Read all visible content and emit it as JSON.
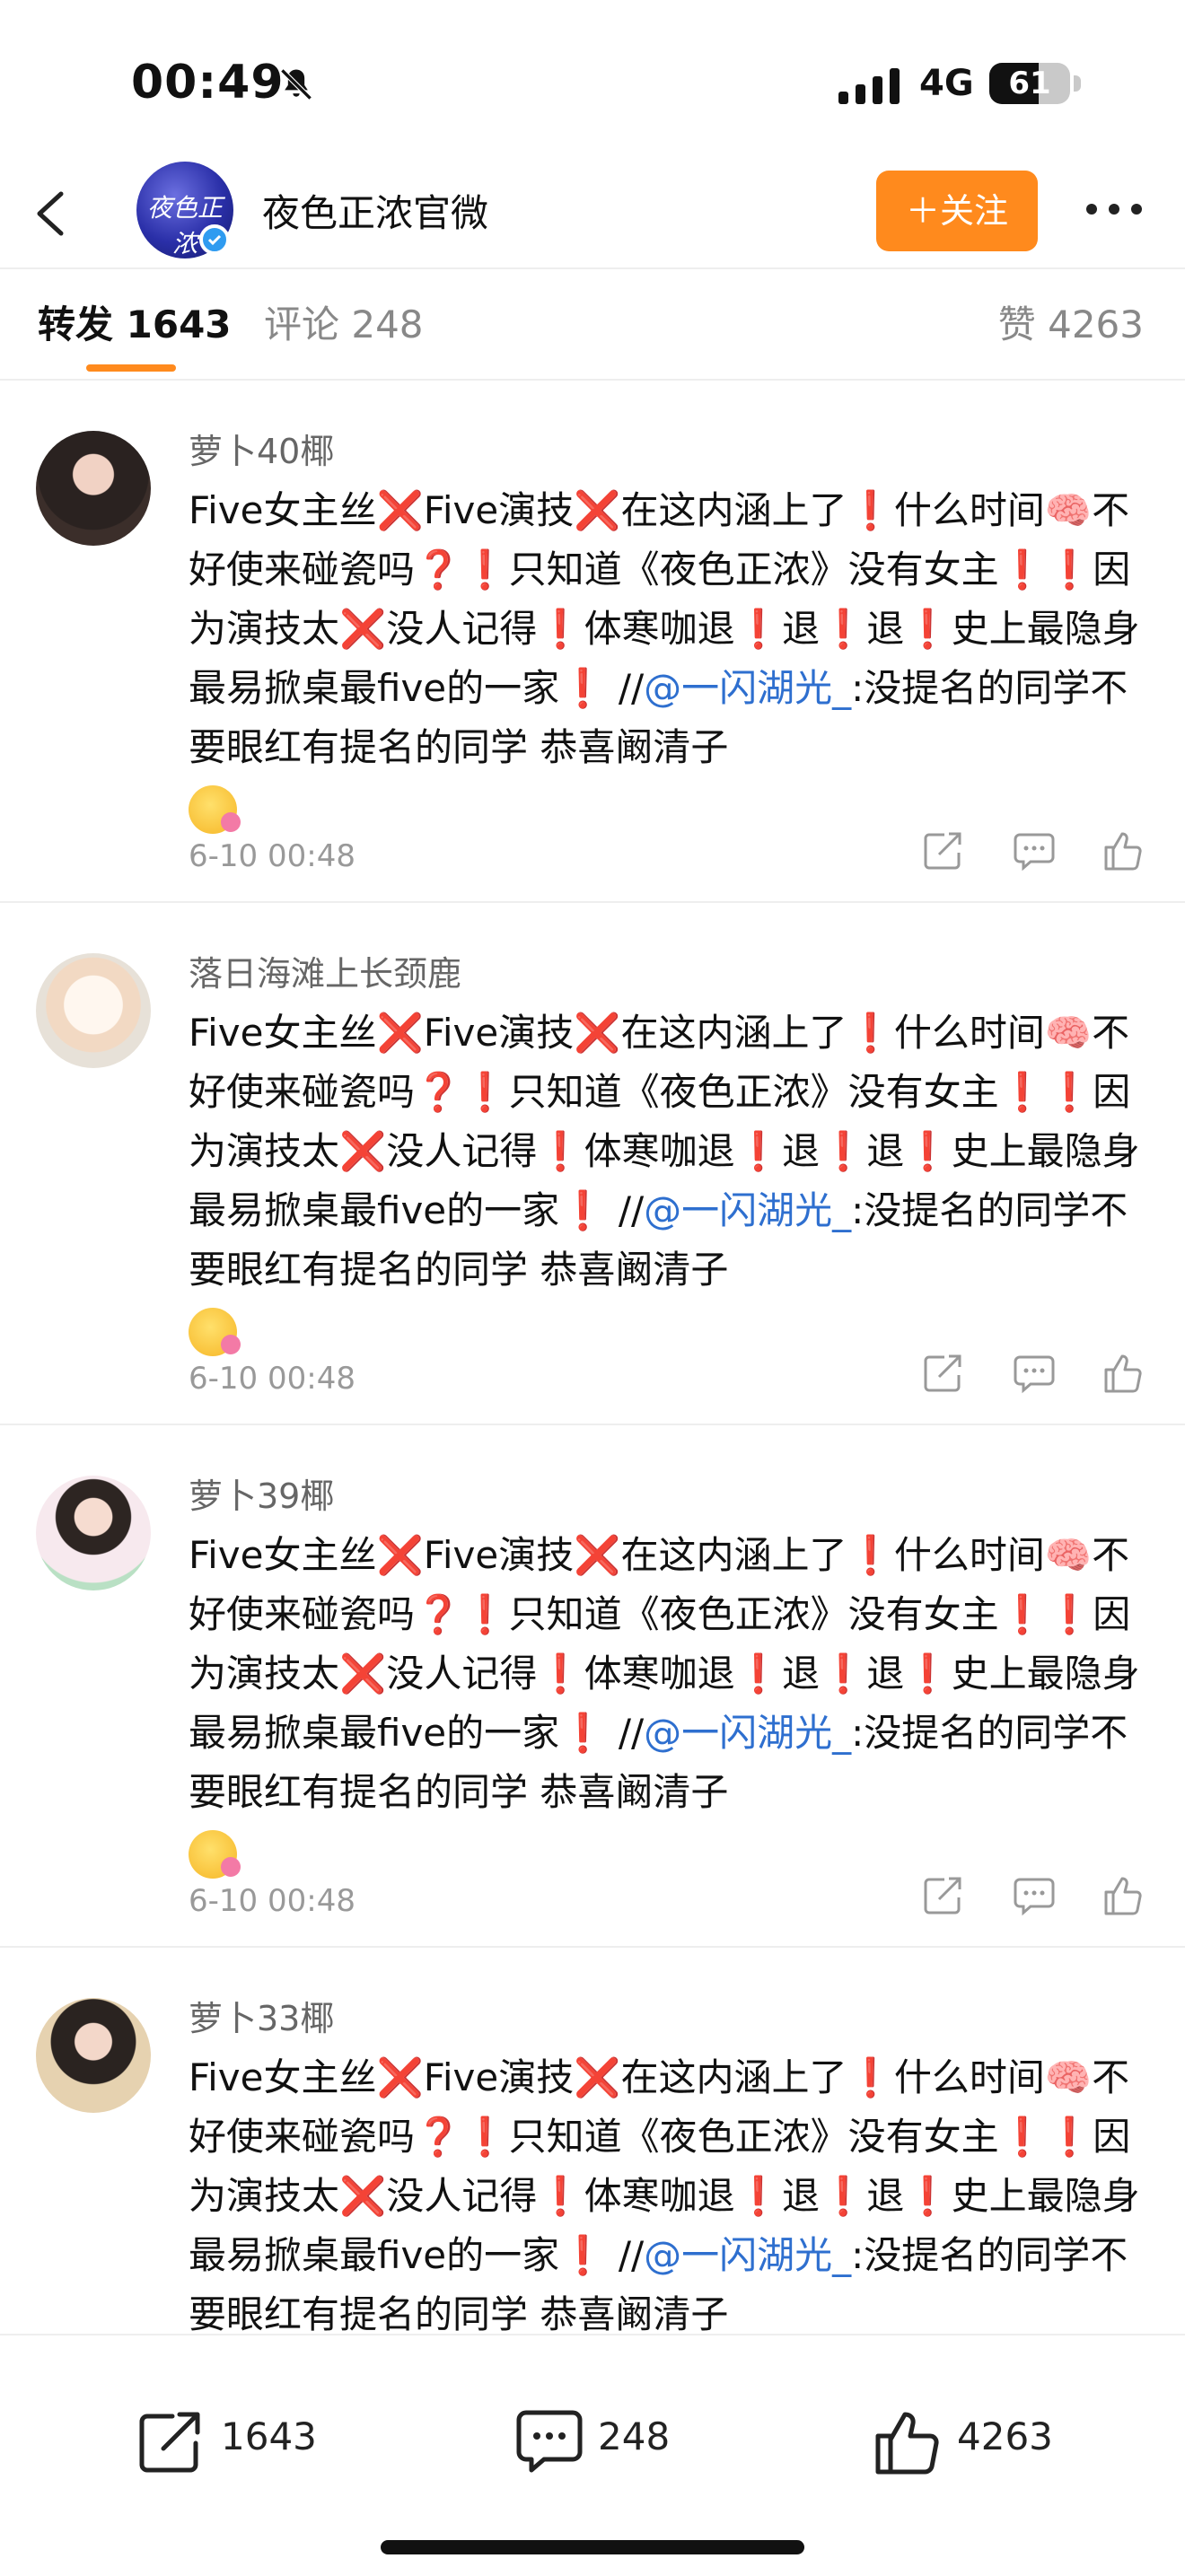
{
  "status": {
    "time": "00:49",
    "network": "4G",
    "battery": "61",
    "battery_level": 0.61
  },
  "header": {
    "title": "夜色正浓官微",
    "follow_label": "＋关注",
    "avatar_text": "夜色正浓"
  },
  "tabs": {
    "repost": "转发 1643",
    "comment": "评论 248",
    "like": "赞 4263"
  },
  "posts": [
    {
      "user": "萝卜40椰",
      "line1a": "Five女主丝",
      "line1b": "Five演技",
      "line1c": "在这内涵上了",
      "line1d": "什么时间",
      "line2a": "不好使来碰瓷吗",
      "line2b": "只知道《夜色正浓》没有女",
      "line3a": "主",
      "line3b": "因为演技太",
      "line3c": "没人记得",
      "line3d": "体寒咖退",
      "line3e": "退",
      "line4a": "退",
      "line4b": "史上最隐身最易掀桌最five的一家",
      "line4c": "//",
      "line4d": "@一闪湖",
      "line5a": "光_",
      "line5b": ":没提名的同学不要眼红有提名的同学 恭喜阚清子",
      "time": "6-10 00:48"
    },
    {
      "user": "落日海滩上长颈鹿",
      "line1a": "Five女主丝",
      "line1b": "Five演技",
      "line1c": "在这内涵上了",
      "line1d": "什么时间",
      "line2a": "不好使来碰瓷吗",
      "line2b": "只知道《夜色正浓》没有女",
      "line3a": "主",
      "line3b": "因为演技太",
      "line3c": "没人记得",
      "line3d": "体寒咖退",
      "line3e": "退",
      "line4a": "退",
      "line4b": "史上最隐身最易掀桌最five的一家",
      "line4c": "//",
      "line4d": "@一闪湖",
      "line5a": "光_",
      "line5b": ":没提名的同学不要眼红有提名的同学 恭喜阚清子",
      "time": "6-10 00:48"
    },
    {
      "user": "萝卜39椰",
      "line1a": "Five女主丝",
      "line1b": "Five演技",
      "line1c": "在这内涵上了",
      "line1d": "什么时间",
      "line2a": "不好使来碰瓷吗",
      "line2b": "只知道《夜色正浓》没有女",
      "line3a": "主",
      "line3b": "因为演技太",
      "line3c": "没人记得",
      "line3d": "体寒咖退",
      "line3e": "退",
      "line4a": "退",
      "line4b": "史上最隐身最易掀桌最five的一家",
      "line4c": "//",
      "line4d": "@一闪湖",
      "line5a": "光_",
      "line5b": ":没提名的同学不要眼红有提名的同学 恭喜阚清子",
      "time": "6-10 00:48"
    },
    {
      "user": "萝卜33椰",
      "line1a": "Five女主丝",
      "line1b": "Five演技",
      "line1c": "在这内涵上了",
      "line1d": "什么时间",
      "line2a": "不好使来碰瓷吗",
      "line2b": "只知道《夜色正浓》没有女",
      "line3a": "主",
      "line3b": "因为演技太",
      "line3c": "没人记得",
      "line3d": "体寒咖退",
      "line3e": "退",
      "line4a": "退",
      "line4b": "史上最隐身最易掀桌最five的一家",
      "line4c": "//",
      "line4d": "@一闪湖",
      "line5a": "光_",
      "line5b": ":没提名的同学不要眼红有提名的同学 恭喜阚清子",
      "time": ""
    }
  ],
  "bottom": {
    "repost_count": "1643",
    "comment_count": "248",
    "like_count": "4263"
  },
  "colors": {
    "accent": "#ff8a1d",
    "link": "#2e6fcf",
    "mark_red": "#e62d2d"
  }
}
